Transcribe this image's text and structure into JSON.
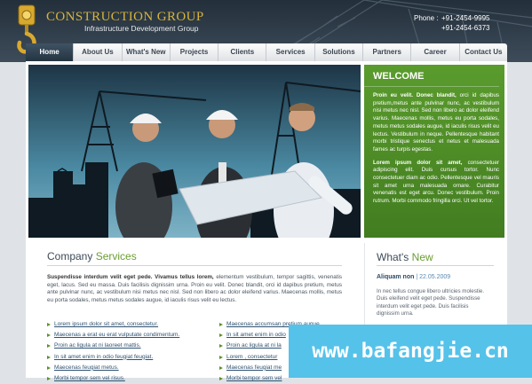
{
  "header": {
    "logo_title": "CONSTRUCTION GROUP",
    "logo_subtitle": "Infrastructure Development Group",
    "phones": [
      {
        "label": "Phone :",
        "number": "+91-2454-9995"
      },
      {
        "label": "",
        "number": "+91-2454-6373"
      }
    ]
  },
  "nav": {
    "items": [
      "Home",
      "About Us",
      "What's New",
      "Projects",
      "Clients",
      "Services",
      "Solutions",
      "Partners",
      "Career",
      "Contact Us"
    ],
    "active": "Home"
  },
  "welcome": {
    "title": "WELCOME",
    "p1_bold": "Proin eu velit. Donec blandit,",
    "p1": " orci id dapibus pretium,metus ante pulvinar nunc, ac vestibulum nisi metus nec nisl. Sed non libero ac dolor eleifend varius. Maecenas mollis, metus eu porta sodales, metus metus sodales augue, id iaculis risus velit eu lectus. Vestibulum in neque. Pellentesque habitant morbi tristique senectus et netus et malesuada fames ac turpis egestas.",
    "p2_bold": "Lorem ipsum dolor sit amet,",
    "p2": " consectetuer adipiscing elit. Duis cursus tortor. Nunc consectetuer diam ac odio. Pellentesque vel mauris sit amet urna malesuada ornare. Curabitur venenatis est eget arcu. Donec vestibulum. Proin rutrum. Morbi commodo fringilla orci. Ut vel tortor."
  },
  "services": {
    "title_a": "Company",
    "title_b": "Services",
    "intro_bold": "Suspendisse interdum velit eget pede. Vivamus tellus lorem,",
    "intro": " elementum vestibulum, tempor sagittis, venenatis eget, lacus. Sed eu massa. Duis facilisis dignissim urna. Proin eu velit. Donec blandit, orci id dapibus pretium, metus ante pulvinar nunc, ac vestibulum nisi metus nec nisl. Sed non libero ac dolor eleifend varius. Maecenas mollis, metus eu porta sodales, metus metus sodales augue, id iaculis risus velit eu lectus.",
    "list1": [
      "Lorem ipsum dolor sit amet, consectetur.",
      "Maecenas a erat eu erat vulputate condimentum.",
      "Proin ac ligula at ni laoreet mattis.",
      "In sit amet enim in odio feugiat feugiat.",
      "Maecenas feugiat metus.",
      "Morbi tempor sem vel risus."
    ],
    "list2": [
      "Maecenas accumsan pretium augue.",
      "In sit amet enim in odio",
      "Proin ac ligula at ni la",
      "Lorem , consectetur",
      "Maecenas feugiat me",
      "Morbi tempor sem vel"
    ]
  },
  "news": {
    "title_a": "What's",
    "title_b": "New",
    "item_title": "Aliquam non",
    "item_date": "22.05.2009",
    "item_text": "In nec tellus congue libero ultricies molestie. Duis eleifend velit eget pede. Suspendisse interdum velit eget pede. Duis facilisis dignissim urna."
  },
  "watermark": "www.bafangjie.cn"
}
